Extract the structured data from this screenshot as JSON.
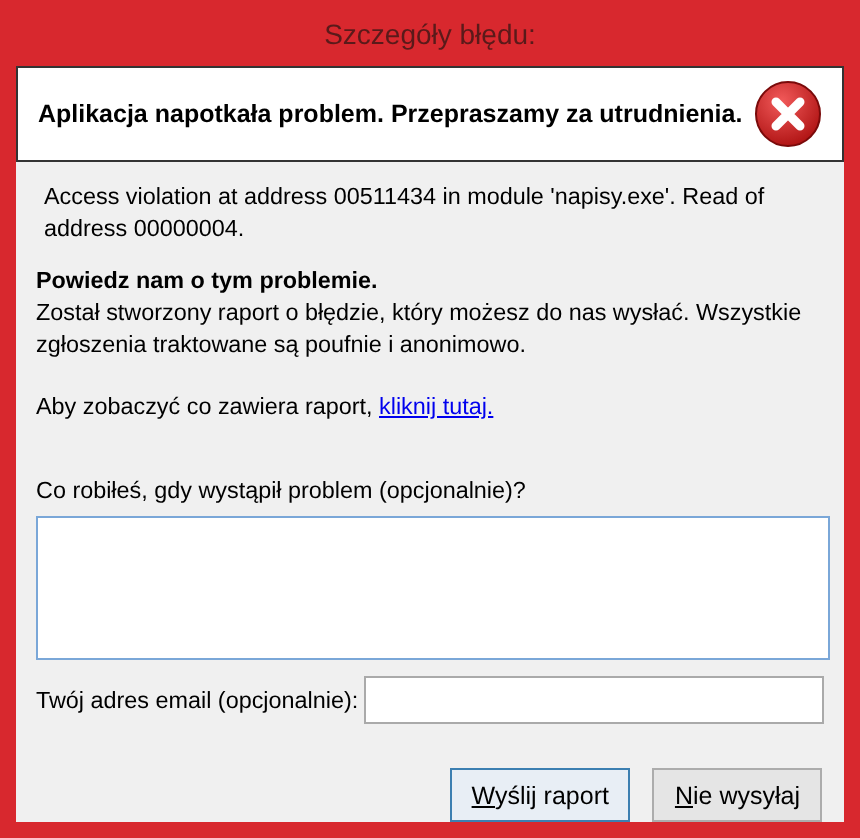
{
  "window": {
    "title": "Szczegóły błędu:"
  },
  "header": {
    "message": "Aplikacja napotkała problem. Przepraszamy za utrudnienia."
  },
  "error_details": "Access violation at address 00511434 in module 'napisy.exe'. Read of address 00000004.",
  "report_heading": "Powiedz nam o tym problemie.",
  "report_text": "Został stworzony raport o błędzie, który możesz do nas wysłać. Wszystkie zgłoszenia traktowane są poufnie i anonimowo.",
  "view_report": {
    "text": "Aby zobaczyć co zawiera raport,",
    "link": "kliknij tutaj."
  },
  "description_field": {
    "label": "Co robiłeś, gdy wystąpił problem (opcjonalnie)?"
  },
  "email_field": {
    "label": "Twój adres email (opcjonalnie):"
  },
  "buttons": [
    {
      "label": "Wyślij raport",
      "mnemonic_underlined": true,
      "default": true
    },
    {
      "label": "Nie wysyłaj",
      "mnemonic_underlined": true,
      "default": false
    }
  ]
}
